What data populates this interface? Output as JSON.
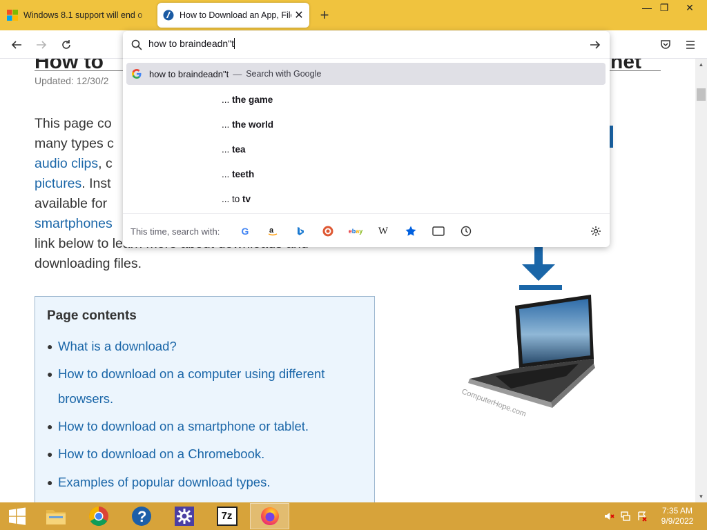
{
  "tabs": [
    {
      "title": "Windows 8.1 support will end o"
    },
    {
      "title": "How to Download an App, File,",
      "close": "✕"
    }
  ],
  "new_tab": "+",
  "window_controls": {
    "minimize": "—",
    "restore": "❐",
    "close": "✕"
  },
  "page": {
    "title_start": "How to",
    "title_end": "net",
    "updated": "Updated: 12/30/2",
    "intro_1": "This page co",
    "intro_2": "many types c",
    "intro_link_1": "audio clips",
    "intro_3": ", c",
    "intro_link_2": "pictures",
    "intro_4": ". Inst",
    "intro_5": "available for",
    "intro_link_3": "smartphones",
    "intro_6": "link below to learn more about downloads and",
    "intro_7": "downloading files.",
    "toc_title": "Page contents",
    "toc_items": [
      "What is a download?",
      "How to download on a computer using different browsers.",
      "How to download on a smartphone or tablet.",
      "How to download on a Chromebook.",
      "Examples of popular download types."
    ],
    "image_watermark": "ComputerHope.com"
  },
  "urlbar": {
    "input_value": "how to braindeadn\"t",
    "google_suggestion": "how to braindeadn\"t",
    "google_separator": "—",
    "google_action": "Search with Google",
    "suggestions": [
      {
        "prefix": "... ",
        "bold": "the game"
      },
      {
        "prefix": "... ",
        "bold": "the world"
      },
      {
        "prefix": "... ",
        "bold": "tea"
      },
      {
        "prefix": "... ",
        "bold": "teeth"
      },
      {
        "prefix": "... to ",
        "bold": "tv"
      }
    ],
    "oneoff_label": "This time, search with:",
    "engines": [
      "google-icon",
      "amazon-icon",
      "bing-icon",
      "duckduckgo-icon",
      "ebay-icon",
      "wikipedia-icon",
      "bookmarks-icon",
      "tabs-icon",
      "history-icon"
    ],
    "engine_glyphs": {
      "wikipedia": "W",
      "ebay": "ebay"
    }
  },
  "taskbar": {
    "time": "7:35 AM",
    "date": "9/9/2022",
    "sevenzip_label": "7z"
  },
  "colors": {
    "tabbar": "#f0c33e",
    "taskbar": "#d7a33a",
    "link": "#1a66a8",
    "toc_bg": "#ecf5fd"
  }
}
